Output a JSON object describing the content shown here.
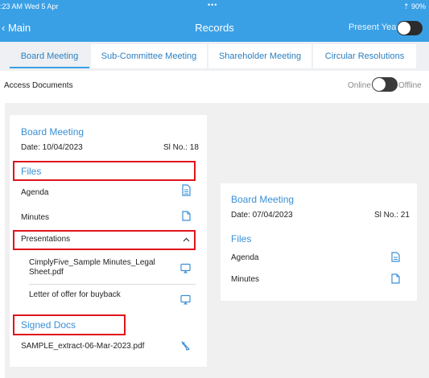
{
  "status_bar": {
    "time": ":23 AM  Wed 5 Apr",
    "dots": "•••",
    "battery": "⇡ 90%"
  },
  "nav": {
    "back": "‹ Main",
    "title": "Records",
    "present_year": "Present Year"
  },
  "tabs": [
    {
      "label": "Board Meeting",
      "active": true
    },
    {
      "label": "Sub-Committee Meeting",
      "active": false
    },
    {
      "label": "Shareholder Meeting",
      "active": false
    },
    {
      "label": "Circular Resolutions",
      "active": false
    }
  ],
  "access": {
    "label": "Access Documents",
    "online": "Online",
    "offline": "Offline"
  },
  "card1": {
    "title": "Board Meeting",
    "date": "Date: 10/04/2023",
    "sl": "Sl No.: 18",
    "files_header": "Files",
    "agenda": "Agenda",
    "minutes": "Minutes",
    "presentations": "Presentations",
    "pres_items": [
      {
        "name": "CimplyFive_Sample Minutes_Legal Sheet.pdf"
      },
      {
        "name": "Letter of offer for buyback"
      }
    ],
    "signed_header": "Signed Docs",
    "signed_file": "SAMPLE_extract-06-Mar-2023.pdf"
  },
  "card2": {
    "title": "Board Meeting",
    "date": "Date: 07/04/2023",
    "sl": "Sl No.: 21",
    "files_header": "Files",
    "agenda": "Agenda",
    "minutes": "Minutes"
  },
  "colors": {
    "accent": "#3aa0e6",
    "highlight": "#e0141b"
  },
  "icons": [
    "document-icon",
    "file-icon",
    "chevron-up-icon",
    "cast-icon",
    "signature-icon",
    "toggle-switch"
  ]
}
